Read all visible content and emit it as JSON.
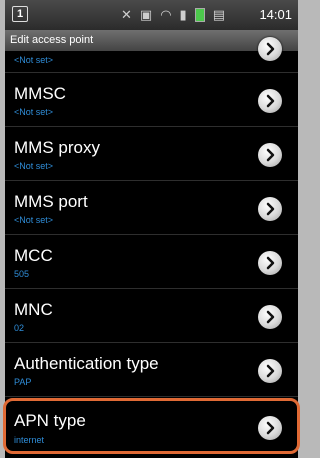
{
  "status_bar": {
    "notification_glyph": "1",
    "time": "14:01",
    "icons": [
      "mute-icon",
      "nfc-icon",
      "wifi-icon",
      "signal-icon",
      "battery-icon",
      "alarm-icon"
    ]
  },
  "title": "Edit access point",
  "rows": [
    {
      "label": "",
      "value": "<Not set>"
    },
    {
      "label": "MMSC",
      "value": "<Not set>"
    },
    {
      "label": "MMS proxy",
      "value": "<Not set>"
    },
    {
      "label": "MMS port",
      "value": "<Not set>"
    },
    {
      "label": "MCC",
      "value": "505"
    },
    {
      "label": "MNC",
      "value": "02"
    },
    {
      "label": "Authentication type",
      "value": "PAP"
    },
    {
      "label": "APN type",
      "value": "internet"
    }
  ],
  "colors": {
    "value_text": "#2f8dd8",
    "highlight": "#e06a35"
  }
}
